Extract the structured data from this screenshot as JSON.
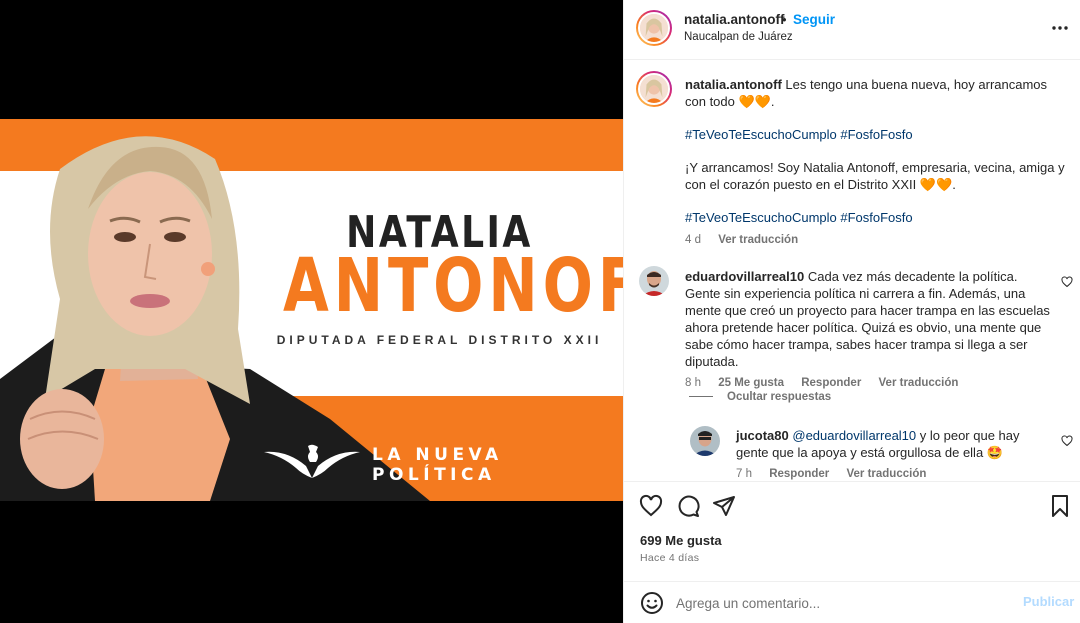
{
  "post": {
    "author": "natalia.antonoff",
    "separator": "•",
    "follow_label": "Seguir",
    "location": "Naucalpan de Juárez"
  },
  "banner": {
    "first_name": "NATALIA",
    "last_name": "ANTONOFF",
    "subtitle": "DIPUTADA FEDERAL DISTRITO XXII",
    "slogan": "LA NUEVA POLÍTICA",
    "brand_orange": "#f47a1f"
  },
  "caption": {
    "username": "natalia.antonoff",
    "line1": "Les tengo una buena nueva, hoy arrancamos con todo 🧡🧡.",
    "hashtags1": "#TeVeoTeEscuchoCumplo #FosfoFosfo",
    "paragraph2": "¡Y arrancamos! Soy Natalia Antonoff, empresaria, vecina, amiga y con el corazón puesto en el Distrito XXII 🧡🧡.",
    "hashtags2": "#TeVeoTeEscuchoCumplo #FosfoFosfo",
    "time": "4 d",
    "translate": "Ver traducción"
  },
  "comment1": {
    "username": "eduardovillarreal10",
    "text": "Cada vez más decadente la política. Gente sin experiencia política ni carrera a fin. Además, una mente que creó un proyecto para hacer trampa en las escuelas ahora pretende hacer política. Quizá es obvio, una mente que sabe cómo hacer trampa, sabes hacer trampa si llega a ser diputada.",
    "time": "8 h",
    "likes": "25 Me gusta",
    "reply": "Responder",
    "translate": "Ver traducción",
    "hide_replies": "Ocultar respuestas"
  },
  "reply1": {
    "username": "jucota80",
    "mention": "@eduardovillarreal10",
    "text": " y lo peor que hay gente que la apoya y está orgullosa de ella 🤩",
    "time": "7 h",
    "reply": "Responder",
    "translate": "Ver traducción"
  },
  "stats": {
    "likes": "699 Me gusta",
    "date": "Hace 4 días"
  },
  "add_comment": {
    "placeholder": "Agrega un comentario...",
    "publish": "Publicar"
  },
  "icons": [
    "more-icon",
    "heart-icon",
    "comment-icon",
    "share-icon",
    "bookmark-icon",
    "emoji-icon"
  ],
  "colors": {
    "link_blue": "#0095f6",
    "hashtag": "#00376b",
    "muted": "#737373",
    "publish_disabled": "#b3dbff"
  }
}
